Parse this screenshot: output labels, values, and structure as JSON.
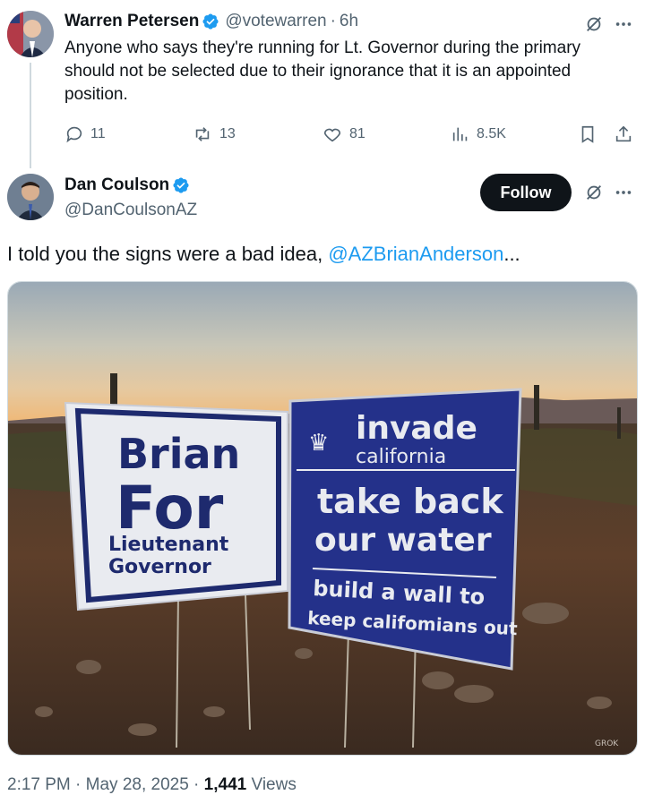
{
  "parent_tweet": {
    "author_name": "Warren Petersen",
    "author_handle": "@votewarren",
    "separator": "·",
    "time_ago": "6h",
    "text": "Anyone who says they're running for Lt. Governor during the primary should not be selected due to their ignorance that it is an appointed position.",
    "replies": "11",
    "reposts": "13",
    "likes": "81",
    "views": "8.5K"
  },
  "main_tweet": {
    "author_name": "Dan Coulson",
    "author_handle": "@DanCoulsonAZ",
    "follow_label": "Follow",
    "text_before": "I told you the signs were a bad idea, ",
    "mention": "@AZBrianAnderson",
    "text_after": "...",
    "image": {
      "left_sign": {
        "line1": "Brian",
        "line2": "For",
        "line3": "Lieutenant",
        "line4": "Governor"
      },
      "right_sign": {
        "line1": "invade",
        "line2": "california",
        "line3": "take back",
        "line4": "our water",
        "line5": "build a wall to",
        "line6": "keep califomians out"
      },
      "watermark": "GROK"
    },
    "timestamp": "2:17 PM · May 28, 2025 · ",
    "views_count": "1,441",
    "views_label": " Views"
  },
  "colors": {
    "verified": "#1d9bf0",
    "link": "#1d9bf0",
    "secondary": "#536471",
    "sign_navy": "#1e2a6e"
  },
  "icons": {
    "grok": "grok-icon",
    "more": "more-icon",
    "reply": "reply-icon",
    "repost": "repost-icon",
    "like": "heart-icon",
    "views": "views-icon",
    "bookmark": "bookmark-icon",
    "share": "share-icon"
  }
}
